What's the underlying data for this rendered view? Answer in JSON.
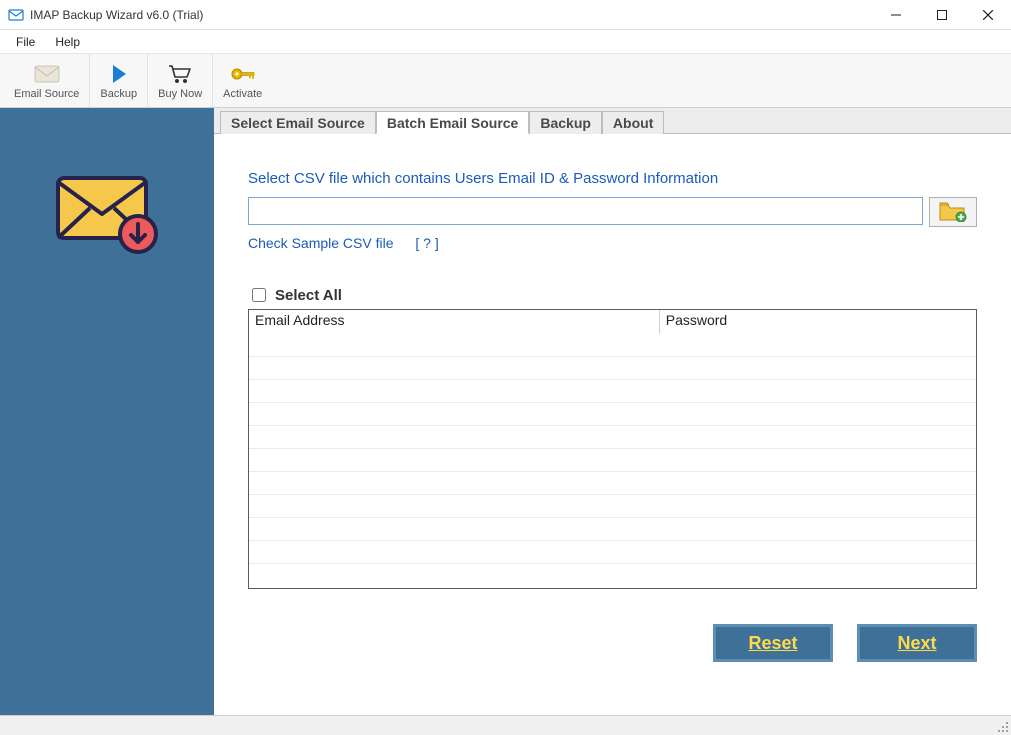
{
  "window": {
    "title": "IMAP Backup Wizard v6.0 (Trial)"
  },
  "menu": {
    "file": "File",
    "help": "Help"
  },
  "toolbar": {
    "email_source": "Email Source",
    "backup": "Backup",
    "buy_now": "Buy Now",
    "activate": "Activate"
  },
  "tabs": {
    "select_email_source": "Select Email Source",
    "batch_email_source": "Batch Email Source",
    "backup": "Backup",
    "about": "About"
  },
  "panel": {
    "instruction": "Select CSV file which contains Users Email ID & Password Information",
    "csv_path": "",
    "check_sample": "Check Sample CSV file",
    "help_link": "[  ?  ]",
    "select_all": "Select All",
    "col_email": "Email Address",
    "col_password": "Password",
    "rows": []
  },
  "buttons": {
    "reset": "Reset",
    "next": "Next"
  }
}
